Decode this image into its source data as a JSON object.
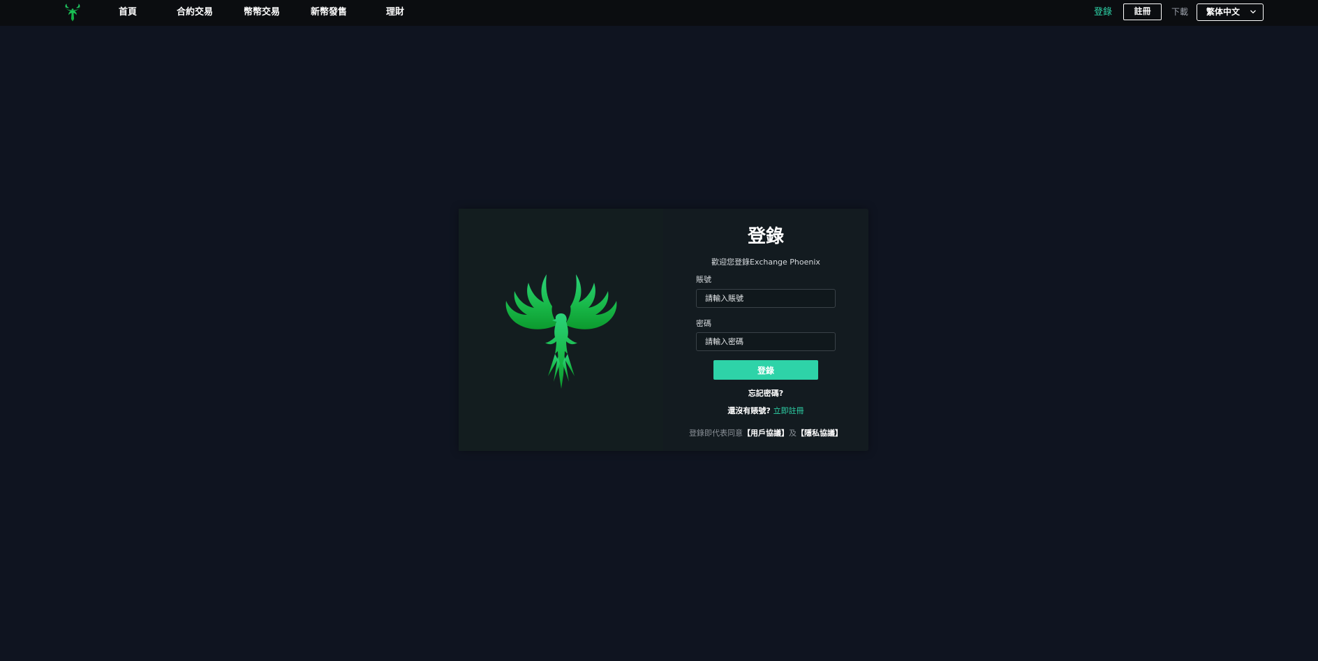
{
  "nav": {
    "items": [
      {
        "label": "首頁"
      },
      {
        "label": "合約交易"
      },
      {
        "label": "幣幣交易"
      },
      {
        "label": "新幣發售"
      },
      {
        "label": "理財"
      }
    ],
    "login_label": "登錄",
    "register_label": "註冊",
    "download_label": "下載",
    "language": "繁体中文"
  },
  "login": {
    "title": "登錄",
    "subtitle": "歡迎您登錄Exchange Phoenix",
    "account_label": "賬號",
    "account_placeholder": "請輸入賬號",
    "password_label": "密碼",
    "password_placeholder": "請輸入密碼",
    "submit_label": "登錄",
    "forgot_label": "忘記密碼?",
    "no_account_text": "還沒有賬號?",
    "register_now_label": "立即註冊",
    "agreement_prefix": "登錄即代表同意",
    "user_agreement": "【用戶協議】",
    "agreement_conj": "及",
    "privacy_agreement": "【隱私協議】"
  },
  "colors": {
    "accent": "#2ed3a8",
    "background": "#0f1420",
    "header": "#0b0d10",
    "card": "#131b20",
    "logo_green": "#1fc04a"
  },
  "icons": {
    "logo": "phoenix-logo-icon",
    "language_dropdown": "chevron-down-icon",
    "card_emblem": "phoenix-emblem"
  }
}
